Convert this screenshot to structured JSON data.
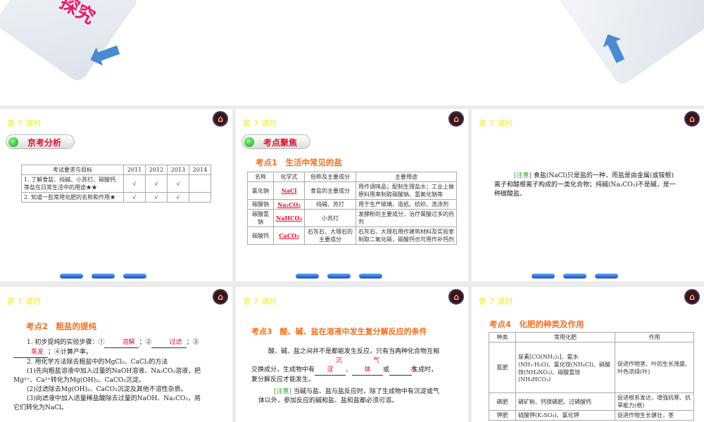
{
  "top_banner": {
    "title_fragment": "探究"
  },
  "lesson_label": "第 7 课时",
  "slides": {
    "s1": {
      "pill": "京考分析",
      "headers": [
        "考试要求与目标",
        "2011",
        "2012",
        "2013",
        "2014"
      ],
      "rows": [
        {
          "goal": "1. 了解食盐、纯碱、小苏打、碳酸钙等盐在日常生活中的用途★★",
          "marks": [
            "√",
            "√",
            "√",
            ""
          ]
        },
        {
          "goal": "2. 知道一些常用化肥的名称和作用★",
          "marks": [
            "√",
            "√",
            "√",
            ""
          ]
        }
      ]
    },
    "s2": {
      "pill": "考点聚焦",
      "heading": "考点1　生活中常见的盐",
      "headers": [
        "名称",
        "化学式",
        "俗称及主要成分",
        "主要用途"
      ],
      "rows": [
        [
          "氯化钠",
          "NaCl",
          "食盐的主要成分",
          "用作调味品；配制生理盐水；工业上做原料用来制取碳酸钠、氢氧化钠等"
        ],
        [
          "碳酸钠",
          "Na₂CO₃",
          "纯碱、苏打",
          "用于生产玻璃、造纸、纺织、洗涤剂"
        ],
        [
          "碳酸氢钠",
          "NaHCO₃",
          "小苏打",
          "发酵粉的主要成分，治疗胃酸过多的药剂"
        ],
        [
          "碳酸钙",
          "CaCO₃",
          "石灰石、大理石的主要成分",
          "石灰石、大理石用作建筑材料及实验室制取二氧化碳，碳酸钙也可用作补钙剂"
        ]
      ]
    },
    "s3": {
      "note_tag": "[注意]",
      "note": "食盐(NaCl)只是盐的一种，而盐是由金属(或铵根)离子和酸根离子构成的一类化合物；纯碱(Na₂CO₃)不是碱，是一种碳酸盐。"
    },
    "s4": {
      "heading": "考点2　粗盐的提纯",
      "l1a": "1. 初步提纯的实验步骤：①",
      "b1": "溶解",
      "l1b": "；②",
      "b2": "过滤",
      "l1c": "；③",
      "b3": "蒸发",
      "l1d": "；④计算产率。",
      "l2": "2. 用化学方法除去粗盐中的MgCl₂、CaCl₂的方法",
      "l3": "(1)先向粗盐溶液中加入过量的NaOH溶液、Na₂CO₃溶液，把Mg²⁺、Ca²⁺转化为Mg(OH)₂、CaCO₃沉淀。",
      "l4": "(2)过滤除去Mg(OH)₂、CaCO₃沉淀及其他不溶性杂质。",
      "l5": "(3)向滤液中加入适量稀盐酸除去过量的NaOH、Na₂CO₃，将它们转化为NaCl。"
    },
    "s5": {
      "heading": "考点3　酸、碱、盐在溶液中发生复分解反应的条件",
      "p1": "酸、碱、盐之间并不是都能发生反应，只有当两种化合物互相交换成分，生成物中有",
      "b1": "沉淀",
      "sep": "、",
      "b2": "气体",
      "or": "或",
      "b3": "水",
      "p2": "生成时，复分解反应才能发生。",
      "note_tag": "[注意]",
      "note": "当碱与盐、盐与盐反应时，除了生成物中有沉淀或气体以外，参加反应的碱和盐、盐和盐都必须可溶。"
    },
    "s6": {
      "heading": "考点4　化肥的种类及作用",
      "headers": [
        "种类",
        "常用化肥",
        "作用"
      ],
      "rows": [
        [
          "氮肥",
          "尿素[CO(NH₂)₂]、氨水(NH₃·H₂O)、氯化铵(NH₄Cl)、硝酸铵(NH₄NO₃)、碳酸氢铵(NH₄HCO₃)",
          "促进作物茎、叶的生长茂盛、叶色浓绿(叶)"
        ],
        [
          "磷肥",
          "磷矿粉、钙镁磷肥、过磷酸钙",
          "促进根系发达，增强抗寒、抗旱能力(根)"
        ],
        [
          "钾肥",
          "硫酸钾(K₂SO₄)、氯化钾",
          "促进作物生长健壮，茎"
        ]
      ]
    }
  }
}
